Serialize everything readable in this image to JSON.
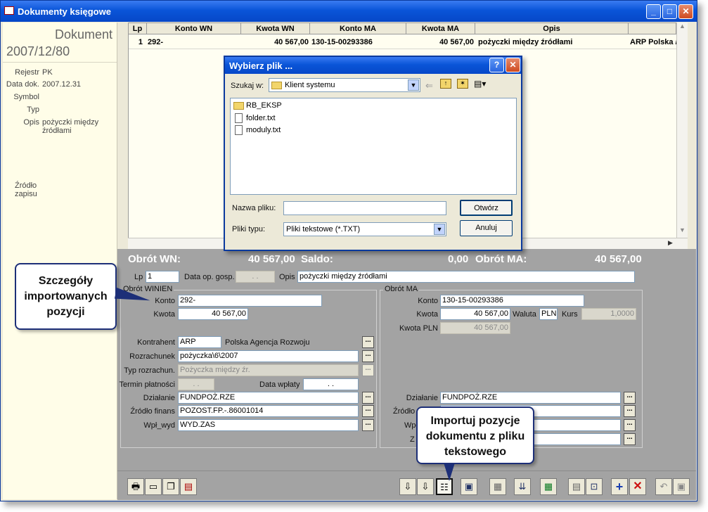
{
  "window": {
    "title": "Dokumenty księgowe"
  },
  "left_panel": {
    "doc_heading": "Dokument",
    "doc_number": "2007/12/80",
    "rows": [
      {
        "key": "Rejestr",
        "value": "PK"
      },
      {
        "key": "Data dok.",
        "value": "2007.12.31"
      },
      {
        "key": "Symbol",
        "value": ""
      },
      {
        "key": "Typ",
        "value": ""
      },
      {
        "key": "Opis",
        "value": "pożyczki między źródłami"
      }
    ],
    "source_label": "Źródło zapisu"
  },
  "grid": {
    "headers": [
      "Lp",
      "Konto WN",
      "Kwota WN",
      "Konto MA",
      "Kwota MA",
      "Opis",
      ""
    ],
    "row": [
      "1",
      "292-",
      "40 567,00",
      "130-15-00293386",
      "40 567,00",
      "pożyczki między źródłami",
      "ARP Polska /"
    ]
  },
  "totals": {
    "wn_label": "Obrót WN:",
    "wn_value": "40 567,00",
    "saldo_label": "Saldo:",
    "saldo_value": "0,00",
    "ma_label": "Obrót MA:",
    "ma_value": "40 567,00"
  },
  "detail": {
    "lp_label": "Lp",
    "lp_value": "1",
    "data_op_label": "Data op. gosp.",
    "data_op_value": ". .",
    "opis_label": "Opis",
    "opis_value": "pożyczki między źródłami",
    "wn": {
      "group": "Obrót WINIEN",
      "konto_label": "Konto",
      "konto_value": "292-",
      "kwota_label": "Kwota",
      "kwota_value": "40 567,00"
    },
    "ma": {
      "group": "Obrót MA",
      "konto_label": "Konto",
      "konto_value": "130-15-00293386",
      "kwota_label": "Kwota",
      "kwota_value": "40 567,00",
      "waluta_label": "Waluta",
      "waluta_value": "PLN",
      "kurs_label": "Kurs",
      "kurs_value": "1,0000",
      "kwota_pln_label": "Kwota PLN",
      "kwota_pln_value": "40 567,00",
      "dzialanie_label": "Działanie",
      "dzialanie_value": "FUNDPOŻ.RZE",
      "zrodlo_label": "Źródło",
      "wpl_label": "Wpł",
      "z_label": "Z"
    },
    "kontrahent_label": "Kontrahent",
    "kontrahent_code": "ARP",
    "kontrahent_name": "Polska Agencja Rozwoju",
    "rozrachunek_label": "Rozrachunek",
    "rozrachunek_value": "pożyczka\\6\\2007",
    "typ_rozr_label": "Typ rozrachun.",
    "typ_rozr_value": "Pożyczka między źr.",
    "termin_label": "Termin płatności",
    "termin_value": ". .",
    "data_wplaty_label": "Data wpłaty",
    "data_wplaty_value": ". .",
    "dzialanie_label": "Działanie",
    "dzialanie_value": "FUNDPOŻ.RZE",
    "zrodlo_label": "Źródło finans",
    "zrodlo_value": "POZOST.FP.-.86001014",
    "wpl_label": "Wpł_wyd",
    "wpl_value": "WYD.ZAS",
    "dots": "..."
  },
  "dialog": {
    "title": "Wybierz plik ...",
    "look_in_label": "Szukaj w:",
    "look_in_value": "Klient systemu",
    "files": [
      {
        "name": "RB_EKSP",
        "icon": "folder-icon"
      },
      {
        "name": "folder.txt",
        "icon": "text-file-icon"
      },
      {
        "name": "moduly.txt",
        "icon": "text-file-icon"
      }
    ],
    "filename_label": "Nazwa pliku:",
    "filename_value": "",
    "filetype_label": "Pliki typu:",
    "filetype_value": "Pliki tekstowe (*.TXT)",
    "open_button": "Otwórz",
    "cancel_button": "Anuluj",
    "help_button": "?",
    "close_button": "✕"
  },
  "callouts": {
    "details": "Szczegóły importowanych pozycji",
    "import": "Importuj pozycje dokumentu z pliku tekstowego"
  },
  "toolbar_icons": [
    "print-icon",
    "preview-icon",
    "copy-icon",
    "export-icon",
    "import-icon-1",
    "import-icon-2",
    "import-text-icon",
    "card-icon",
    "form-icon",
    "split-icon",
    "calculator-icon",
    "table-icon",
    "post-icon",
    "add-icon",
    "delete-icon",
    "undo-icon",
    "save-icon"
  ]
}
